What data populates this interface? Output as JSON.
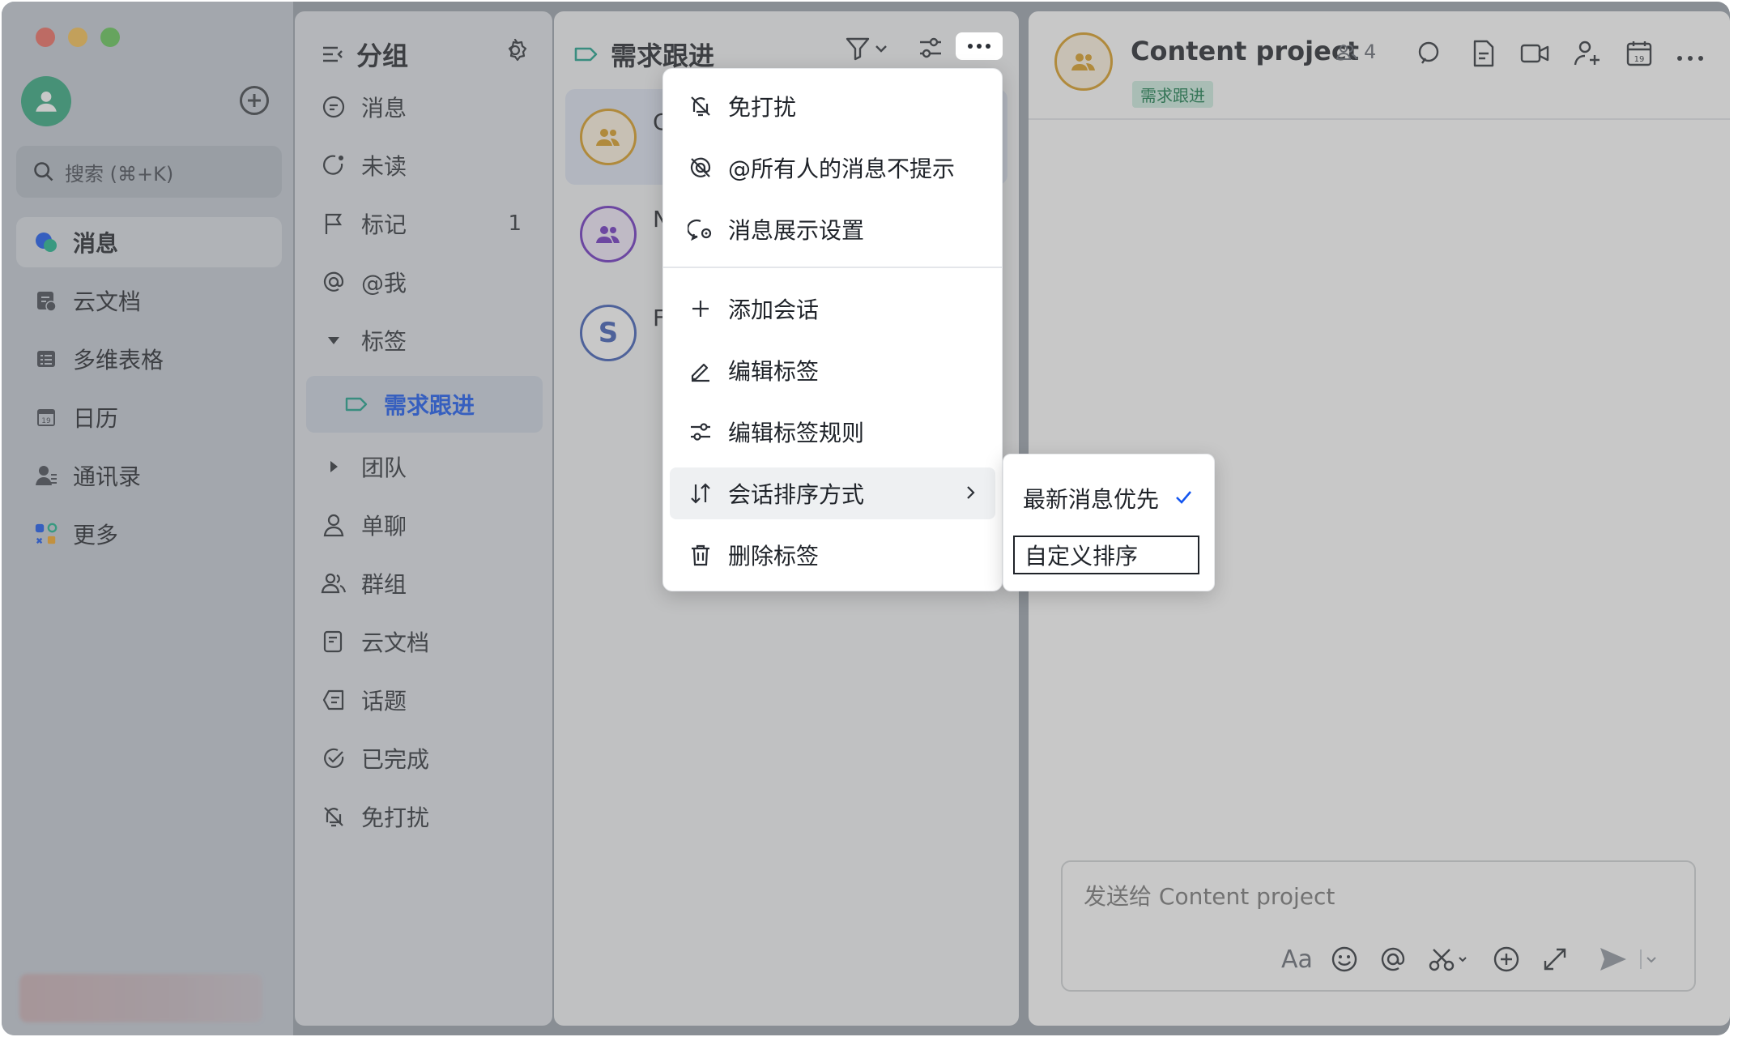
{
  "colors": {
    "accent_blue": "#1456f0",
    "tag_green": "#137a4a",
    "tag_green_bg": "#cdeee0",
    "avatar_gold": "#d99b1d",
    "avatar_purple": "#6b2fc0",
    "avatar_blue": "#3b5bb5"
  },
  "app_sidebar": {
    "search_placeholder": "搜索 (⌘+K)",
    "nav": [
      {
        "label": "消息",
        "icon": "message-bubble-icon"
      },
      {
        "label": "云文档",
        "icon": "cloud-doc-icon"
      },
      {
        "label": "多维表格",
        "icon": "base-table-icon"
      },
      {
        "label": "日历",
        "icon": "calendar-icon"
      },
      {
        "label": "通讯录",
        "icon": "contacts-icon"
      },
      {
        "label": "更多",
        "icon": "more-apps-icon"
      }
    ]
  },
  "group_panel": {
    "title": "分组",
    "items": [
      {
        "label": "消息"
      },
      {
        "label": "未读"
      },
      {
        "label": "标记",
        "count": "1"
      },
      {
        "label": "@我"
      },
      {
        "label": "标签"
      },
      {
        "label": "需求跟进"
      },
      {
        "label": "团队"
      },
      {
        "label": "单聊"
      },
      {
        "label": "群组"
      },
      {
        "label": "云文档"
      },
      {
        "label": "话题"
      },
      {
        "label": "已完成"
      },
      {
        "label": "免打扰"
      }
    ]
  },
  "chat_list": {
    "title": "需求跟进",
    "rows": [
      {
        "name": "C",
        "avatar": "group"
      },
      {
        "name": "N",
        "avatar": "group"
      },
      {
        "name": "F",
        "avatar": "S"
      }
    ]
  },
  "menu": {
    "items": [
      {
        "label": "免打扰"
      },
      {
        "label": "@所有人的消息不提示"
      },
      {
        "label": "消息展示设置"
      },
      {
        "label": "添加会话"
      },
      {
        "label": "编辑标签"
      },
      {
        "label": "编辑标签规则"
      },
      {
        "label": "会话排序方式"
      },
      {
        "label": "删除标签"
      }
    ],
    "submenu": [
      {
        "label": "最新消息优先",
        "checked": true
      },
      {
        "label": "自定义排序",
        "checked": false
      }
    ]
  },
  "conversation": {
    "title": "Content project",
    "member_count": "4",
    "tag": "需求跟进",
    "composer_placeholder": "发送给 Content project",
    "font_button": "Aa"
  }
}
